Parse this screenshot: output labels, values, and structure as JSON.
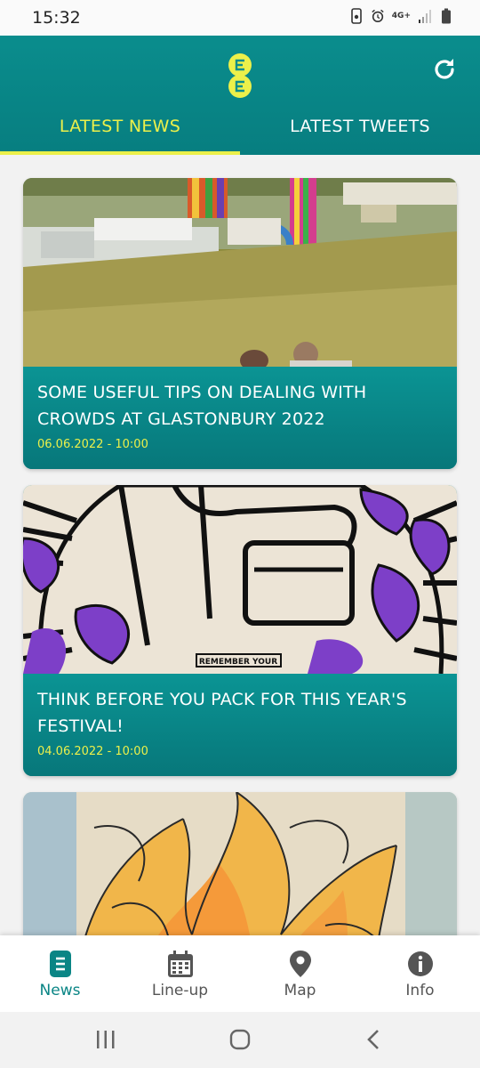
{
  "status": {
    "time": "15:32",
    "network": "4G+"
  },
  "tabs": [
    {
      "label": "LATEST NEWS",
      "active": true
    },
    {
      "label": "LATEST TWEETS",
      "active": false
    }
  ],
  "articles": [
    {
      "title": "SOME USEFUL TIPS ON DEALING WITH CROWDS AT GLASTONBURY 2022",
      "date": "06.06.2022 - 10:00"
    },
    {
      "title": "THINK BEFORE YOU PACK FOR THIS YEAR'S FESTIVAL!",
      "date": "04.06.2022 - 10:00",
      "image_text": "REMEMBER YOUR"
    },
    {
      "title": "",
      "date": ""
    }
  ],
  "bottom_nav": [
    {
      "label": "News",
      "icon": "news-icon",
      "active": true
    },
    {
      "label": "Line-up",
      "icon": "calendar-icon",
      "active": false
    },
    {
      "label": "Map",
      "icon": "map-pin-icon",
      "active": false
    },
    {
      "label": "Info",
      "icon": "info-icon",
      "active": false
    }
  ],
  "colors": {
    "teal": "#0a8d8d",
    "accent_yellow": "#ecf04a",
    "nav_active": "#0a8585"
  }
}
